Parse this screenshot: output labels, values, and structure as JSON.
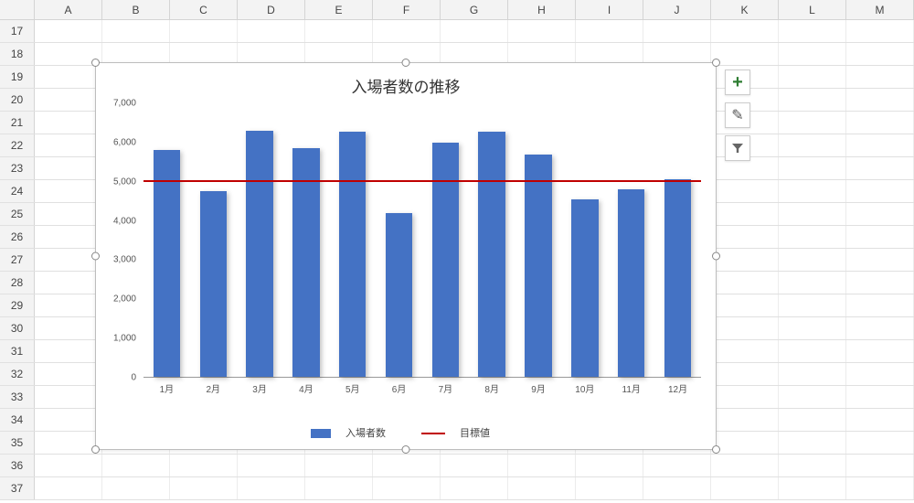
{
  "columns": [
    "A",
    "B",
    "C",
    "D",
    "E",
    "F",
    "G",
    "H",
    "I",
    "J",
    "K",
    "L",
    "M"
  ],
  "row_start": 17,
  "row_end": 37,
  "chart_title": "入場者数の推移",
  "legend": {
    "series1": "入場者数",
    "series2": "目標値"
  },
  "yticks": [
    "0",
    "1,000",
    "2,000",
    "3,000",
    "4,000",
    "5,000",
    "6,000",
    "7,000"
  ],
  "side_buttons": {
    "add": "+",
    "style": "✎",
    "filter": "▾"
  },
  "chart_data": {
    "type": "bar",
    "title": "入場者数の推移",
    "categories": [
      "1月",
      "2月",
      "3月",
      "4月",
      "5月",
      "6月",
      "7月",
      "8月",
      "9月",
      "10月",
      "11月",
      "12月"
    ],
    "series": [
      {
        "name": "入場者数",
        "type": "bar",
        "values": [
          5800,
          4750,
          6300,
          5850,
          6280,
          4200,
          6000,
          6280,
          5700,
          4550,
          4800,
          5050
        ]
      },
      {
        "name": "目標値",
        "type": "line",
        "value": 5000
      }
    ],
    "ylabel": "",
    "xlabel": "",
    "ylim": [
      0,
      7000
    ],
    "ytick_interval": 1000
  }
}
